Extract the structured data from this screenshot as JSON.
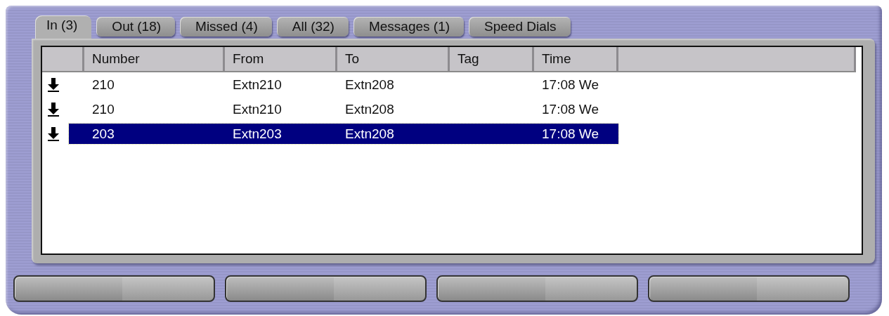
{
  "tabs": [
    {
      "label": "In (3)",
      "selected": true
    },
    {
      "label": "Out (18)",
      "selected": false
    },
    {
      "label": "Missed (4)",
      "selected": false
    },
    {
      "label": "All (32)",
      "selected": false
    },
    {
      "label": "Messages (1)",
      "selected": false
    },
    {
      "label": "Speed Dials",
      "selected": false
    }
  ],
  "table": {
    "columns": [
      "Number",
      "From",
      "To",
      "Tag",
      "Time"
    ],
    "rows": [
      {
        "kind": "incoming",
        "selected": false,
        "cells": [
          "210",
          "Extn210",
          "Extn208",
          "",
          "17:08 We"
        ]
      },
      {
        "kind": "incoming",
        "selected": false,
        "cells": [
          "210",
          "Extn210",
          "Extn208",
          "",
          "17:08 We"
        ]
      },
      {
        "kind": "incoming",
        "selected": true,
        "cells": [
          "203",
          "Extn203",
          "Extn208",
          "",
          "17:08 We"
        ]
      }
    ]
  },
  "buttons": [
    {
      "kind": "blank"
    },
    {
      "kind": "blank"
    },
    {
      "kind": "blank"
    },
    {
      "kind": "blank"
    }
  ]
}
